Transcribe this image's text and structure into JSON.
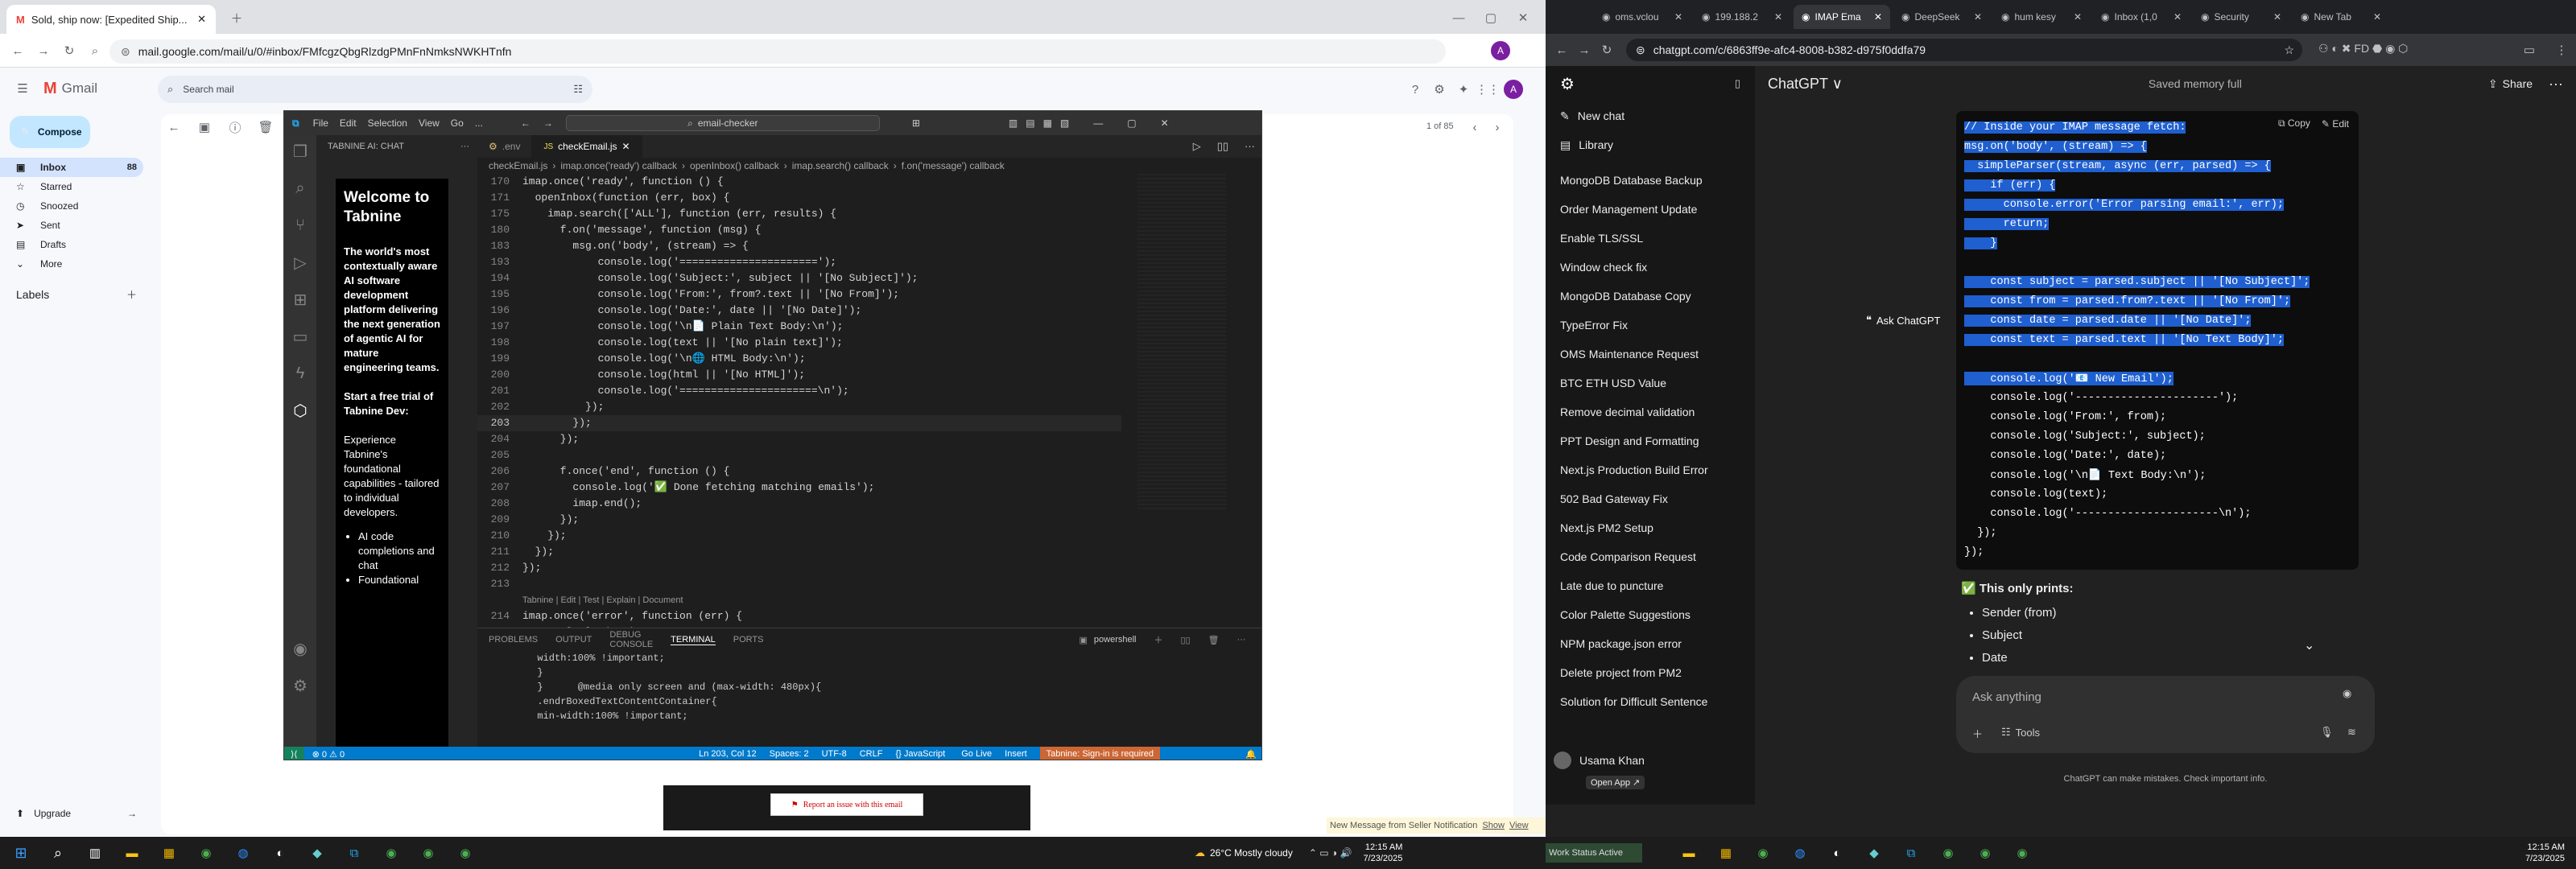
{
  "left_browser": {
    "tabs": [
      {
        "title": "Sold, ship now: [Expedited Ship...",
        "active": true
      }
    ],
    "url": "mail.google.com/mail/u/0/#inbox/FMfcgzQbgRlzdgPMnFnNmksNWKHTnfn",
    "profile_initial": "A"
  },
  "gmail": {
    "logo": "Gmail",
    "search_placeholder": "Search mail",
    "compose_label": "Compose",
    "nav": [
      {
        "label": "Inbox",
        "count": "88"
      },
      {
        "label": "Starred",
        "count": ""
      },
      {
        "label": "Snoozed",
        "count": ""
      },
      {
        "label": "Sent",
        "count": ""
      },
      {
        "label": "Drafts",
        "count": ""
      },
      {
        "label": "More",
        "count": ""
      }
    ],
    "labels_heading": "Labels",
    "upgrade_label": "Upgrade",
    "pager": "1 of 85",
    "report_label": "Report an issue with this email"
  },
  "vscode": {
    "menu": [
      "File",
      "Edit",
      "Selection",
      "View",
      "Go",
      "..."
    ],
    "search_text": "email-checker",
    "panel_title": "TABNINE AI: CHAT",
    "tabnine": {
      "heading": "Welcome to Tabnine",
      "para1": "The world's most contextually aware AI software development platform delivering the next generation of agentic AI for mature engineering teams.",
      "para2": "Start a free trial of Tabnine Dev:",
      "para3": "Experience Tabnine's foundational capabilities - tailored to individual developers.",
      "bullets": [
        "AI code completions and chat",
        "Foundational"
      ]
    },
    "tabs": [
      {
        "label": ".env",
        "active": false
      },
      {
        "label": "checkEmail.js",
        "active": true
      }
    ],
    "breadcrumbs": [
      "checkEmail.js",
      "imap.once('ready') callback",
      "openInbox() callback",
      "imap.search() callback",
      "f.on('message') callback"
    ],
    "code_lines": [
      {
        "n": "170",
        "t": "imap.once('ready', function () {"
      },
      {
        "n": "171",
        "t": "  openInbox(function (err, box) {"
      },
      {
        "n": "175",
        "t": "    imap.search(['ALL'], function (err, results) {"
      },
      {
        "n": "180",
        "t": "      f.on('message', function (msg) {"
      },
      {
        "n": "183",
        "t": "        msg.on('body', (stream) => {"
      },
      {
        "n": "193",
        "t": "            console.log('======================');"
      },
      {
        "n": "194",
        "t": "            console.log('Subject:', subject || '[No Subject]');"
      },
      {
        "n": "195",
        "t": "            console.log('From:', from?.text || '[No From]');"
      },
      {
        "n": "196",
        "t": "            console.log('Date:', date || '[No Date]');"
      },
      {
        "n": "197",
        "t": "            console.log('\\n📄 Plain Text Body:\\n');"
      },
      {
        "n": "198",
        "t": "            console.log(text || '[No plain text]');"
      },
      {
        "n": "199",
        "t": "            console.log('\\n🌐 HTML Body:\\n');"
      },
      {
        "n": "200",
        "t": "            console.log(html || '[No HTML]');"
      },
      {
        "n": "201",
        "t": "            console.log('======================\\n');"
      },
      {
        "n": "202",
        "t": "          });"
      },
      {
        "n": "203",
        "t": "        });"
      },
      {
        "n": "204",
        "t": "      });"
      },
      {
        "n": "205",
        "t": ""
      },
      {
        "n": "206",
        "t": "      f.once('end', function () {"
      },
      {
        "n": "207",
        "t": "        console.log('✅ Done fetching matching emails');"
      },
      {
        "n": "208",
        "t": "        imap.end();"
      },
      {
        "n": "209",
        "t": "      });"
      },
      {
        "n": "210",
        "t": "    });"
      },
      {
        "n": "211",
        "t": "  });"
      },
      {
        "n": "212",
        "t": "});"
      },
      {
        "n": "213",
        "t": ""
      },
      {
        "n": "",
        "t": "Tabnine | Edit | Test | Explain | Document"
      },
      {
        "n": "214",
        "t": "imap.once('error', function (err) {"
      },
      {
        "n": "215",
        "t": "  console.log(err);"
      }
    ],
    "panel_tabs": [
      "PROBLEMS",
      "OUTPUT",
      "DEBUG CONSOLE",
      "TERMINAL",
      "PORTS"
    ],
    "active_panel_tab": "TERMINAL",
    "terminal_shell": "powershell",
    "terminal_lines": [
      "  width:100% !important;",
      "  }",
      "  }      @media only screen and (max-width: 480px){",
      "  .endrBoxedTextContentContainer{",
      "  min-width:100% !important;"
    ],
    "status": {
      "left": "⊗ 0 ⚠ 0",
      "position": "Ln 203, Col 12",
      "spaces": "Spaces: 2",
      "encoding": "UTF-8",
      "eol": "CRLF",
      "language": "{} JavaScript",
      "golive": "Go Live",
      "insert": "Insert",
      "tabnine": "Tabnine: Sign-in is required"
    }
  },
  "left_taskbar": {
    "weather": "26°C  Mostly cloudy",
    "time": "12:15 AM",
    "date": "7/23/2025",
    "notification": "New Message from Seller Notification",
    "notification_show": "Show",
    "notification_view": "View"
  },
  "right_browser": {
    "tabs": [
      {
        "title": "oms.vclou",
        "active": false
      },
      {
        "title": "199.188.2",
        "active": false
      },
      {
        "title": "IMAP Ema",
        "active": true
      },
      {
        "title": "DeepSeek",
        "active": false
      },
      {
        "title": "hum kesy",
        "active": false
      },
      {
        "title": "Inbox (1,0",
        "active": false
      },
      {
        "title": "Security",
        "active": false
      },
      {
        "title": "New Tab",
        "active": false
      }
    ],
    "url": "chatgpt.com/c/6863ff9e-afc4-8008-b382-d975f0ddfa79"
  },
  "chatgpt": {
    "new_chat": "New chat",
    "library": "Library",
    "history": [
      "MongoDB Database Backup",
      "Order Management Update",
      "Enable TLS/SSL",
      "Window check fix",
      "MongoDB Database Copy",
      "TypeError Fix",
      "OMS Maintenance Request",
      "BTC ETH USD Value",
      "Remove decimal validation",
      "PPT Design and Formatting",
      "Next.js Production Build Error",
      "502 Bad Gateway Fix",
      "Next.js PM2 Setup",
      "Code Comparison Request",
      "Late due to puncture",
      "Color Palette Suggestions",
      "NPM package.json error",
      "Delete project from PM2",
      "Solution for Difficult Sentence"
    ],
    "user_name": "Usama Khan",
    "open_app": "Open App ↗",
    "model": "ChatGPT ∨",
    "memory": "Saved memory full",
    "share": "Share",
    "copy": "Copy",
    "edit": "Edit",
    "ask_chatgpt": "Ask ChatGPT",
    "code_lines": [
      {
        "t": "// Inside your IMAP message fetch:",
        "sel": true
      },
      {
        "t": "msg.on('body', (stream) => {",
        "sel": true
      },
      {
        "t": "  simpleParser(stream, async (err, parsed) => {",
        "sel": true
      },
      {
        "t": "    if (err) {",
        "sel": true
      },
      {
        "t": "      console.error('Error parsing email:', err);",
        "sel": true
      },
      {
        "t": "      return;",
        "sel": true
      },
      {
        "t": "    }",
        "sel": true
      },
      {
        "t": "",
        "sel": false
      },
      {
        "t": "    const subject = parsed.subject || '[No Subject]';",
        "sel": true
      },
      {
        "t": "    const from = parsed.from?.text || '[No From]';",
        "sel": true
      },
      {
        "t": "    const date = parsed.date || '[No Date]';",
        "sel": true
      },
      {
        "t": "    const text = parsed.text || '[No Text Body]';",
        "sel": true
      },
      {
        "t": "",
        "sel": false
      },
      {
        "t": "    console.log('📧 New Email');",
        "sel": true
      },
      {
        "t": "    console.log('----------------------');",
        "sel": false
      },
      {
        "t": "    console.log('From:', from);",
        "sel": false
      },
      {
        "t": "    console.log('Subject:', subject);",
        "sel": false
      },
      {
        "t": "    console.log('Date:', date);",
        "sel": false
      },
      {
        "t": "    console.log('\\n📄 Text Body:\\n');",
        "sel": false
      },
      {
        "t": "    console.log(text);",
        "sel": false
      },
      {
        "t": "    console.log('----------------------\\n');",
        "sel": false
      },
      {
        "t": "  });",
        "sel": false
      },
      {
        "t": "});",
        "sel": false
      }
    ],
    "prints_heading": "✅ This only prints:",
    "prints": [
      "Sender (from)",
      "Subject",
      "Date"
    ],
    "input_placeholder": "Ask anything",
    "tools": "Tools",
    "disclaimer": "ChatGPT can make mistakes. Check important info."
  },
  "right_taskbar": {
    "widget": "Work Status Active",
    "time": "12:15 AM",
    "date": "7/23/2025"
  },
  "colors": {
    "vscode_blue": "#007acc",
    "selection": "#1f5fd0",
    "gmail_active": "#d3e3fd"
  }
}
